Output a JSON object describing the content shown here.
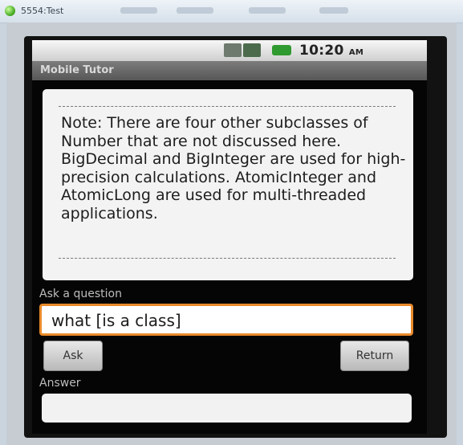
{
  "window": {
    "title": "5554:Test"
  },
  "status_bar": {
    "time": "10:20",
    "ampm": "AM"
  },
  "app": {
    "title": "Mobile Tutor"
  },
  "note": {
    "text": "Note: There are four other subclasses of Number that are not discussed here. BigDecimal and BigInteger are used for high-precision calculations. AtomicInteger and AtomicLong are used for multi-threaded applications."
  },
  "question": {
    "label": "Ask a question",
    "value": "what [is a class]"
  },
  "buttons": {
    "ask": "Ask",
    "return": "Return"
  },
  "answer": {
    "label": "Answer",
    "value": ""
  },
  "colors": {
    "focus_border": "#e98a2a",
    "battery": "#2f9a2f"
  },
  "icons": {
    "app": "emulator-app-icon",
    "network": "data-transfer-icon",
    "signal": "signal-strength-icon",
    "battery": "battery-icon"
  }
}
